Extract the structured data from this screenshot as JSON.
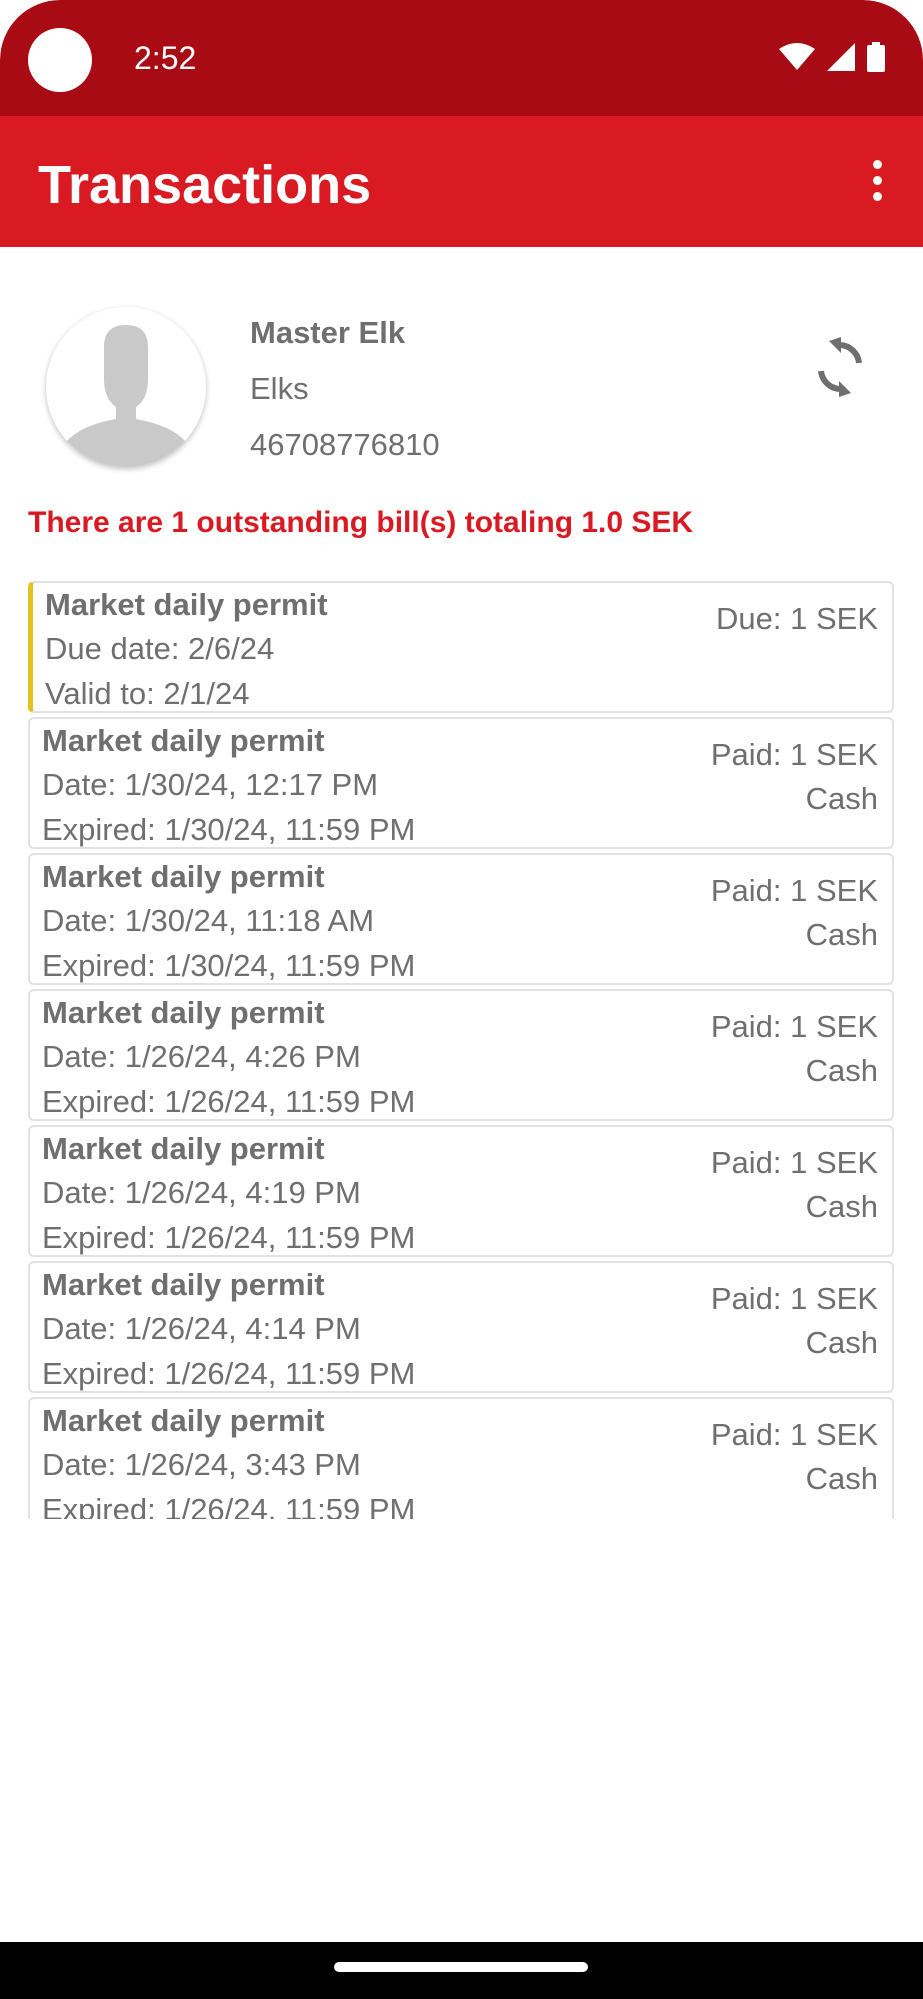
{
  "status_bar": {
    "time": "2:52"
  },
  "app_bar": {
    "title": "Transactions"
  },
  "profile": {
    "name": "Master Elk",
    "organization": "Elks",
    "phone": "46708776810"
  },
  "alert": "There are 1 outstanding bill(s) totaling 1.0 SEK",
  "transactions": [
    {
      "title": "Market daily permit",
      "line1": "Due date: 2/6/24",
      "line2": "Valid to: 2/1/24",
      "amount": "Due: 1 SEK",
      "method": ""
    },
    {
      "title": "Market daily permit",
      "line1": "Date: 1/30/24, 12:17 PM",
      "line2": "Expired: 1/30/24, 11:59 PM",
      "amount": "Paid: 1 SEK",
      "method": "Cash"
    },
    {
      "title": "Market daily permit",
      "line1": "Date: 1/30/24, 11:18 AM",
      "line2": "Expired: 1/30/24, 11:59 PM",
      "amount": "Paid: 1 SEK",
      "method": "Cash"
    },
    {
      "title": "Market daily permit",
      "line1": "Date: 1/26/24, 4:26 PM",
      "line2": "Expired: 1/26/24, 11:59 PM",
      "amount": "Paid: 1 SEK",
      "method": "Cash"
    },
    {
      "title": "Market daily permit",
      "line1": "Date: 1/26/24, 4:19 PM",
      "line2": "Expired: 1/26/24, 11:59 PM",
      "amount": "Paid: 1 SEK",
      "method": "Cash"
    },
    {
      "title": "Market daily permit",
      "line1": "Date: 1/26/24, 4:14 PM",
      "line2": "Expired: 1/26/24, 11:59 PM",
      "amount": "Paid: 1 SEK",
      "method": "Cash"
    },
    {
      "title": "Market daily permit",
      "line1": "Date: 1/26/24, 3:43 PM",
      "line2": "Expired: 1/26/24, 11:59 PM",
      "amount": "Paid: 1 SEK",
      "method": "Cash"
    }
  ],
  "colors": {
    "status_bar": "#a90b14",
    "app_bar": "#d91a22",
    "alert_text": "#d91a22",
    "due_accent": "#e3c21b",
    "text": "#6f6f6f"
  },
  "icons": [
    "camera-icon",
    "wifi-icon",
    "signal-icon",
    "battery-icon",
    "overflow-menu-icon",
    "avatar-placeholder-icon",
    "refresh-icon"
  ]
}
